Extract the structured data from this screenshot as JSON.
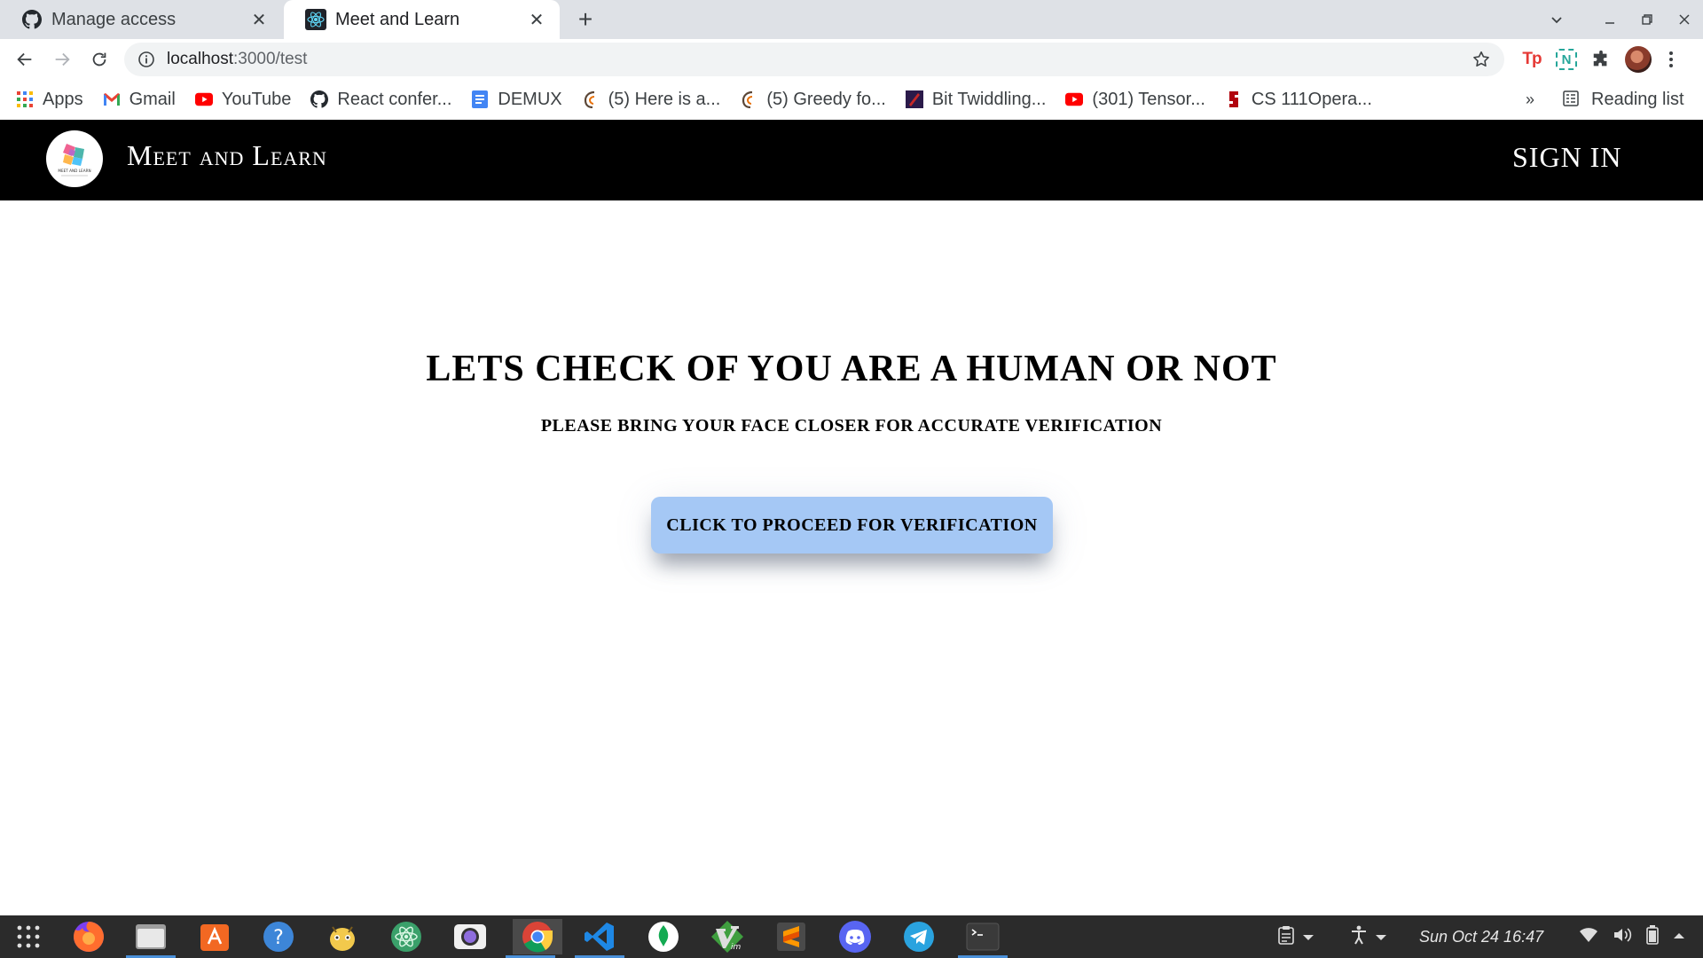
{
  "browser": {
    "tabs": [
      {
        "title": "Manage access",
        "icon": "github-icon",
        "active": false
      },
      {
        "title": "Meet and Learn",
        "icon": "react-icon",
        "active": true
      }
    ],
    "address": {
      "host": "localhost",
      "path": ":3000/test"
    },
    "bookmarks": [
      {
        "label": "Apps",
        "icon": "apps-grid-icon"
      },
      {
        "label": "Gmail",
        "icon": "gmail-icon"
      },
      {
        "label": "YouTube",
        "icon": "youtube-icon"
      },
      {
        "label": "React confer...",
        "icon": "github-icon"
      },
      {
        "label": "DEMUX",
        "icon": "docs-icon"
      },
      {
        "label": "(5) Here is a...",
        "icon": "codechef-icon"
      },
      {
        "label": "(5) Greedy fo...",
        "icon": "codechef-icon"
      },
      {
        "label": "Bit Twiddling...",
        "icon": "bit-twiddling-icon"
      },
      {
        "label": "(301) Tensor...",
        "icon": "youtube-icon"
      },
      {
        "label": "CS 111Opera...",
        "icon": "stanford-icon"
      }
    ],
    "bookmarks_overflow": "»",
    "reading_list": "Reading list",
    "extensions": [
      "Tp",
      "N"
    ]
  },
  "app": {
    "brand": "Meet and Learn",
    "sign_in": "SIGN IN",
    "logo_text": "MEET AND LEARN",
    "title": "LETS CHECK OF YOU ARE A HUMAN OR NOT",
    "subtitle": "PLEASE BRING YOUR FACE CLOSER FOR ACCURATE VERIFICATION",
    "button": "CLICK TO PROCEED FOR VERIFICATION"
  },
  "taskbar": {
    "clock": "Sun Oct 24  16:47"
  },
  "colors": {
    "header_bg": "#000000",
    "button_bg": "#a5c8f5",
    "tabstrip_bg": "#dee1e6",
    "dock_bg": "#2b2b2b"
  }
}
